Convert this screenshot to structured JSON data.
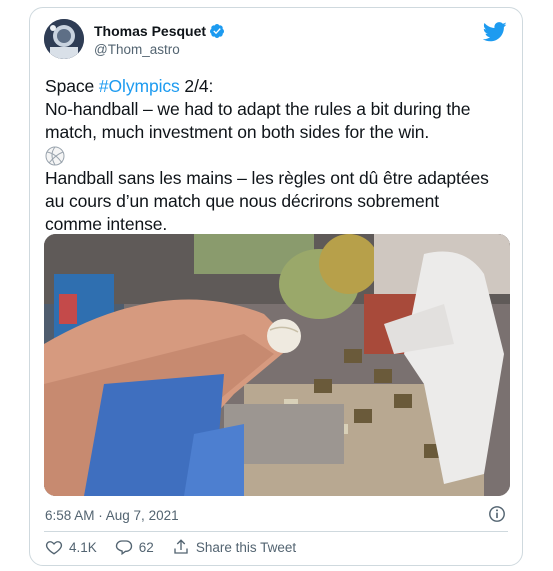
{
  "tweet": {
    "author_name": "Thomas Pesquet",
    "author_handle": "@Thom_astro",
    "text_prefix": "Space ",
    "hashtag": "#Olympics",
    "text_suffix": " 2/4:",
    "line_en_1": "No-handball – we had to adapt the rules a bit during the",
    "line_en_2": "match, much investment on both sides for the win.",
    "emoji": "volleyball",
    "line_fr_1": "Handball sans les mains – les règles ont dû être adaptées",
    "line_fr_2": "au cours d’un match que nous décrirons sobrement",
    "line_fr_3": "comme intense.",
    "timestamp": "6:58 AM · Aug 7, 2021"
  },
  "actions": {
    "like_count": "4.1K",
    "reply_count": "62",
    "share_label": "Share this Tweet"
  },
  "icons": {
    "verified": "verified-badge-icon",
    "logo": "twitter-bird-icon",
    "info": "info-icon",
    "like": "heart-icon",
    "reply": "reply-icon",
    "share": "share-icon"
  },
  "colors": {
    "accent": "#1d9bf0",
    "text": "#0f1419",
    "secondary": "#536471",
    "border": "#cfd9de"
  }
}
